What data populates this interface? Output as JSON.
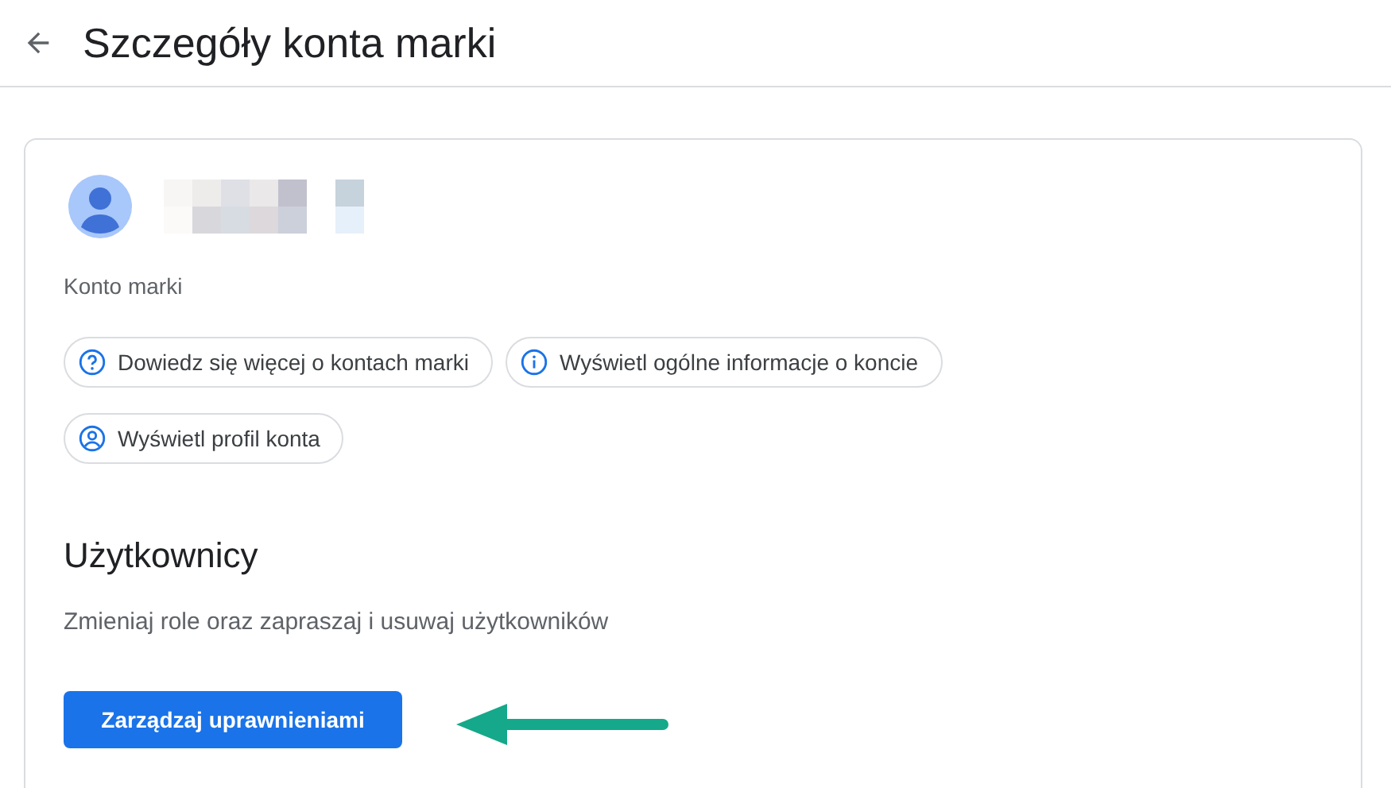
{
  "header": {
    "title": "Szczegóły konta marki"
  },
  "account": {
    "type_label": "Konto marki"
  },
  "chips": [
    {
      "kind": "help",
      "label": "Dowiedz się więcej o kontach marki"
    },
    {
      "kind": "info",
      "label": "Wyświetl ogólne informacje o koncie"
    },
    {
      "kind": "profile",
      "label": "Wyświetl profil konta"
    }
  ],
  "users": {
    "heading": "Użytkownicy",
    "description": "Zmieniaj role oraz zapraszaj i usuwaj użytkowników",
    "button": "Zarządzaj uprawnieniami"
  }
}
